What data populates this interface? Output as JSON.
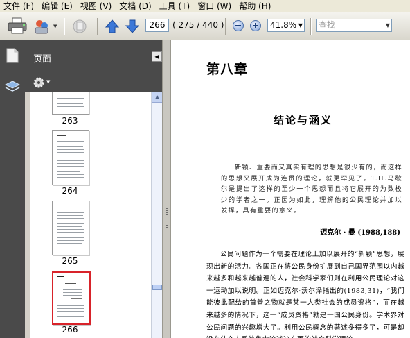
{
  "menu": [
    "文件 (F)",
    "编辑 (E)",
    "视图 (V)",
    "文档 (D)",
    "工具 (T)",
    "窗口 (W)",
    "帮助 (H)"
  ],
  "toolbar": {
    "current_page": "266",
    "page_count": "( 275 / 440 )",
    "zoom": "41.8%",
    "search_placeholder": "查找"
  },
  "panel": {
    "title": "页面",
    "thumbnails": [
      {
        "label": "263",
        "selected": false
      },
      {
        "label": "264",
        "selected": false
      },
      {
        "label": "265",
        "selected": false
      },
      {
        "label": "266",
        "selected": true
      }
    ]
  },
  "document": {
    "chapter": "第八章",
    "title": "结论与涵义",
    "quote": "新颖、重要而又真实有理的思想是很少有的，而这样的思想又展开成为连贯的理论，就更罕见了。T.H.马歇尔是提出了这样的至少一个思想而且将它展开的为数极少的学者之一。正因为如此，理解他的公民理论并加以发挥，具有重要的意义。",
    "attribution": "迈克尔 · 曼 (1988,188)",
    "body": "公民问题作为一个需要在理论上加以展开的“新颖”思想，展现出新的活力。各国正在将公民身份扩展到自己国界范围以内越来越多和越来越普遍的人，社会科学家们则在利用公民理论对这一运动加以说明。正如迈克尔·沃尔泽指出的(1983,31)，“我们能彼此配给的首善之物就是某一人类社会的成员资格”，而在越来越多的情况下，这一“成员资格”就是一国公民身份。学术界对公民问题的兴趣增大了。利用公民概念的著述多得多了，可是却没有什么人系统集中论述这方面的社会科学理论。"
  }
}
